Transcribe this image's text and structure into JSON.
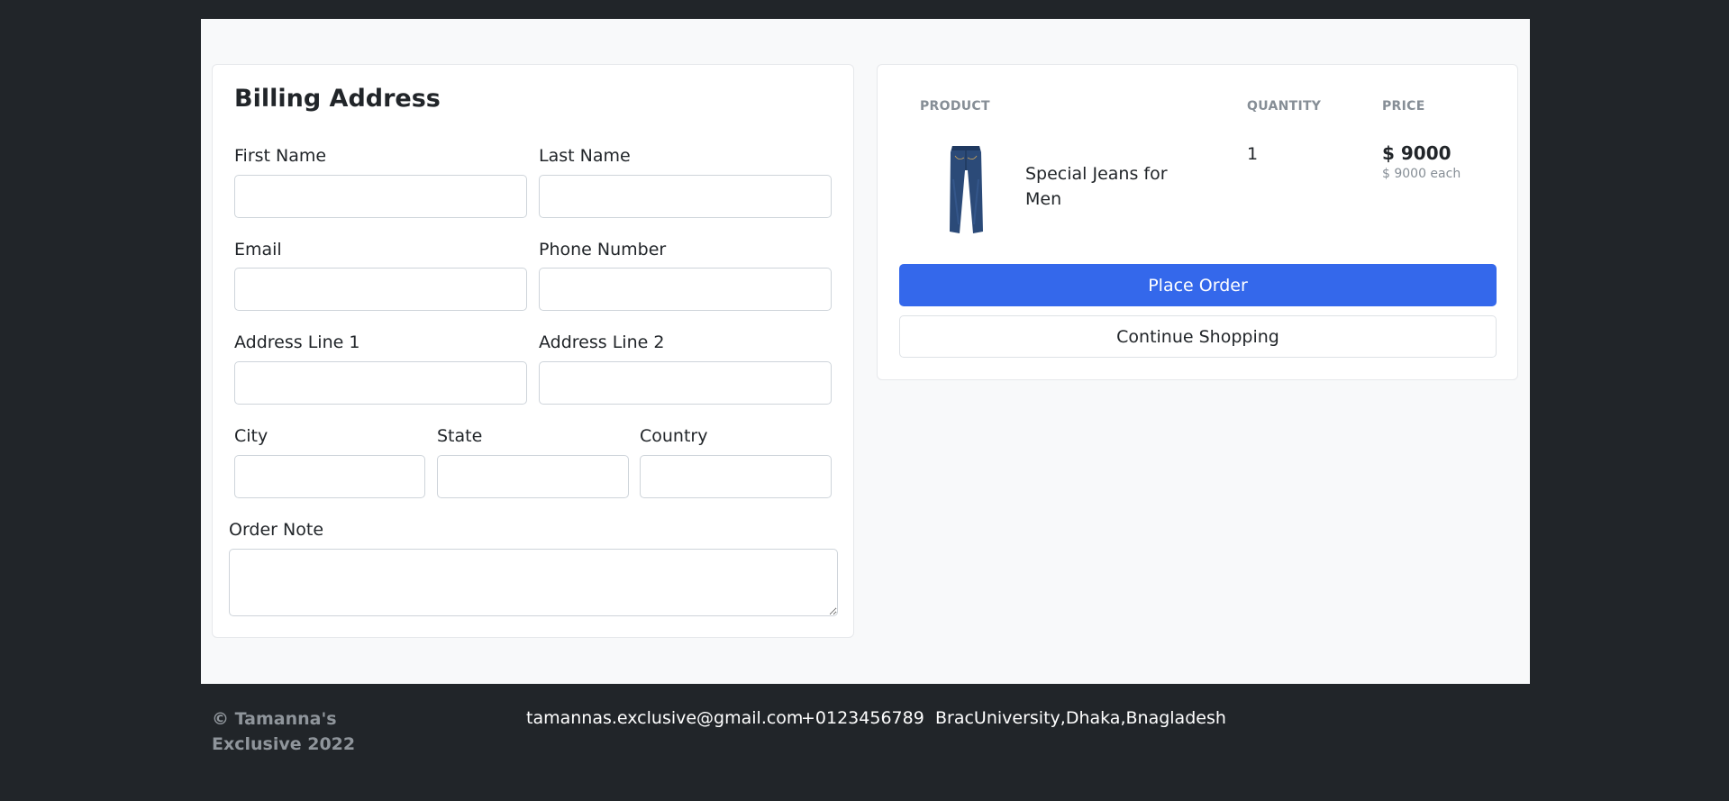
{
  "billing": {
    "title": "Billing Address",
    "fields": {
      "first_name": {
        "label": "First Name",
        "value": "",
        "placeholder": ""
      },
      "last_name": {
        "label": "Last Name",
        "value": "",
        "placeholder": ""
      },
      "email": {
        "label": "Email",
        "value": "",
        "placeholder": ""
      },
      "phone": {
        "label": "Phone Number",
        "value": "",
        "placeholder": ""
      },
      "address1": {
        "label": "Address Line 1",
        "value": "",
        "placeholder": ""
      },
      "address2": {
        "label": "Address Line 2",
        "value": "",
        "placeholder": ""
      },
      "city": {
        "label": "City",
        "value": "",
        "placeholder": ""
      },
      "state": {
        "label": "State",
        "value": "",
        "placeholder": ""
      },
      "country": {
        "label": "Country",
        "value": "",
        "placeholder": ""
      },
      "order_note": {
        "label": "Order Note",
        "value": "",
        "placeholder": ""
      }
    }
  },
  "order": {
    "headers": {
      "product": "PRODUCT",
      "quantity": "QUANTITY",
      "price": "PRICE"
    },
    "items": [
      {
        "name": "Special Jeans for Men",
        "quantity": "1",
        "price": "$ 9000",
        "price_each": "$ 9000 each",
        "image_icon": "jeans-icon"
      }
    ],
    "place_order_label": "Place Order",
    "continue_label": "Continue Shopping"
  },
  "footer": {
    "copyright": "© Tamanna's Exclusive 2022",
    "email": "tamannas.exclusive@gmail.com",
    "phone": "+0123456789",
    "address": "BracUniversity,Dhaka,Bnagladesh"
  },
  "colors": {
    "background": "#212529",
    "content_bg": "#f8f9fa",
    "primary": "#3468eb",
    "muted": "#868e96"
  }
}
